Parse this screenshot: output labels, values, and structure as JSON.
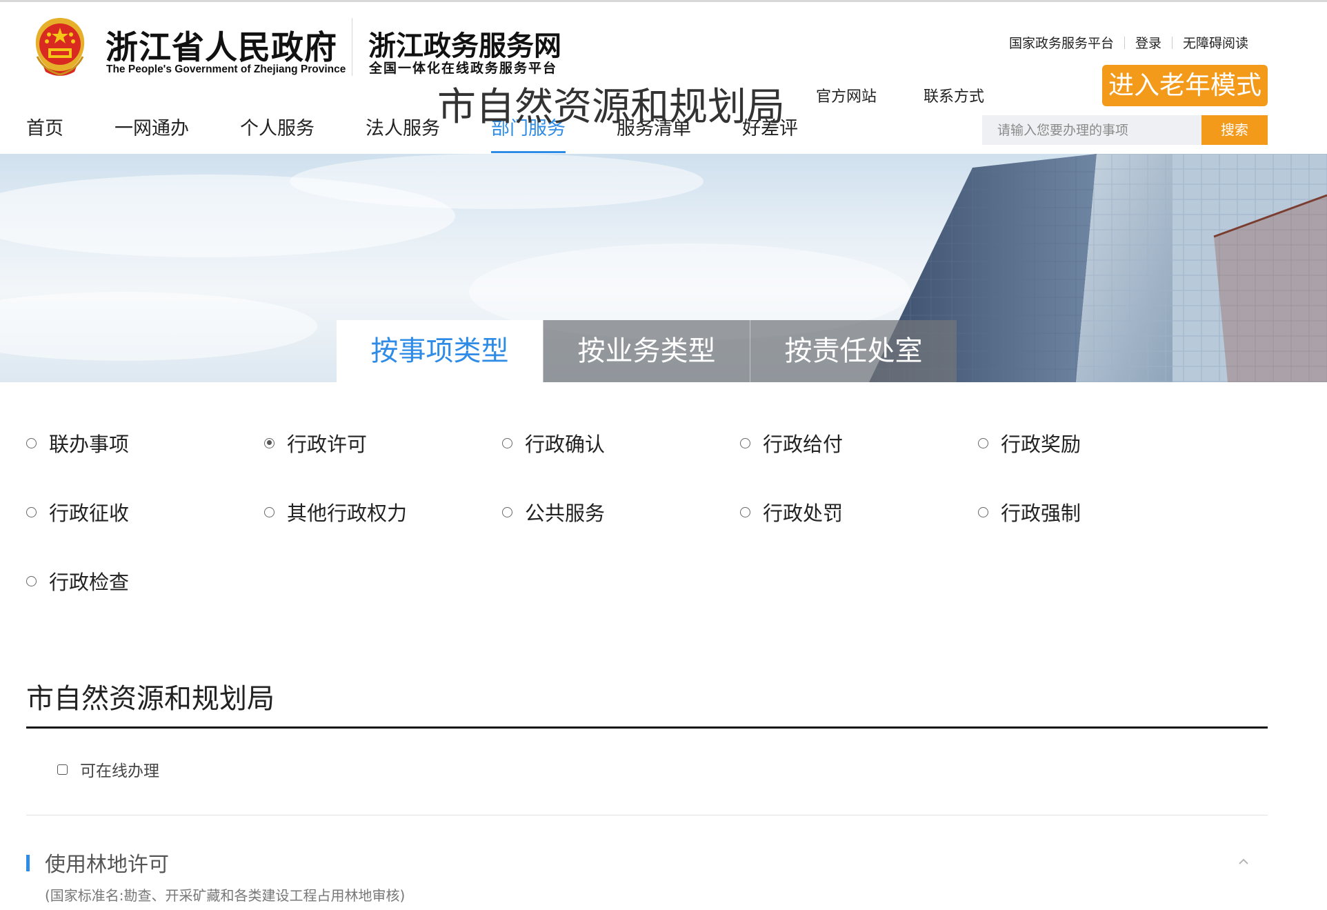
{
  "header": {
    "gov_title": "浙江省人民政府",
    "gov_subtitle_en": "The People's Government of Zhejiang Province",
    "portal_title": "浙江政务服务网",
    "portal_subtitle": "全国一体化在线政务服务平台",
    "top_links": [
      "国家政务服务平台",
      "登录",
      "无障碍阅读"
    ],
    "elder_mode_label": "进入老年模式",
    "emblem_icon": "national-emblem-icon"
  },
  "nav": {
    "items": [
      "首页",
      "一网通办",
      "个人服务",
      "法人服务",
      "部门服务",
      "服务清单",
      "好差评"
    ],
    "active": "部门服务"
  },
  "search": {
    "placeholder": "请输入您要办理的事项",
    "button_label": "搜索"
  },
  "banner": {
    "department_name": "市自然资源和规划局",
    "links": [
      "官方网站",
      "联系方式"
    ],
    "tabs": [
      "按事项类型",
      "按业务类型",
      "按责任处室"
    ],
    "active_tab": "按事项类型"
  },
  "filters": {
    "options": [
      "联办事项",
      "行政许可",
      "行政确认",
      "行政给付",
      "行政奖励",
      "行政征收",
      "其他行政权力",
      "公共服务",
      "行政处罚",
      "行政强制",
      "行政检查"
    ],
    "selected": "行政许可"
  },
  "section": {
    "title": "市自然资源和规划局",
    "online_checkbox_label": "可在线办理",
    "online_checked": false
  },
  "service_item": {
    "title": "使用林地许可",
    "standard_name": "(国家标准名:勘查、开采矿藏和各类建设工程占用林地审核)",
    "expanded": true
  },
  "colors": {
    "accent_blue": "#2e8be6",
    "accent_orange": "#f39a1b"
  }
}
